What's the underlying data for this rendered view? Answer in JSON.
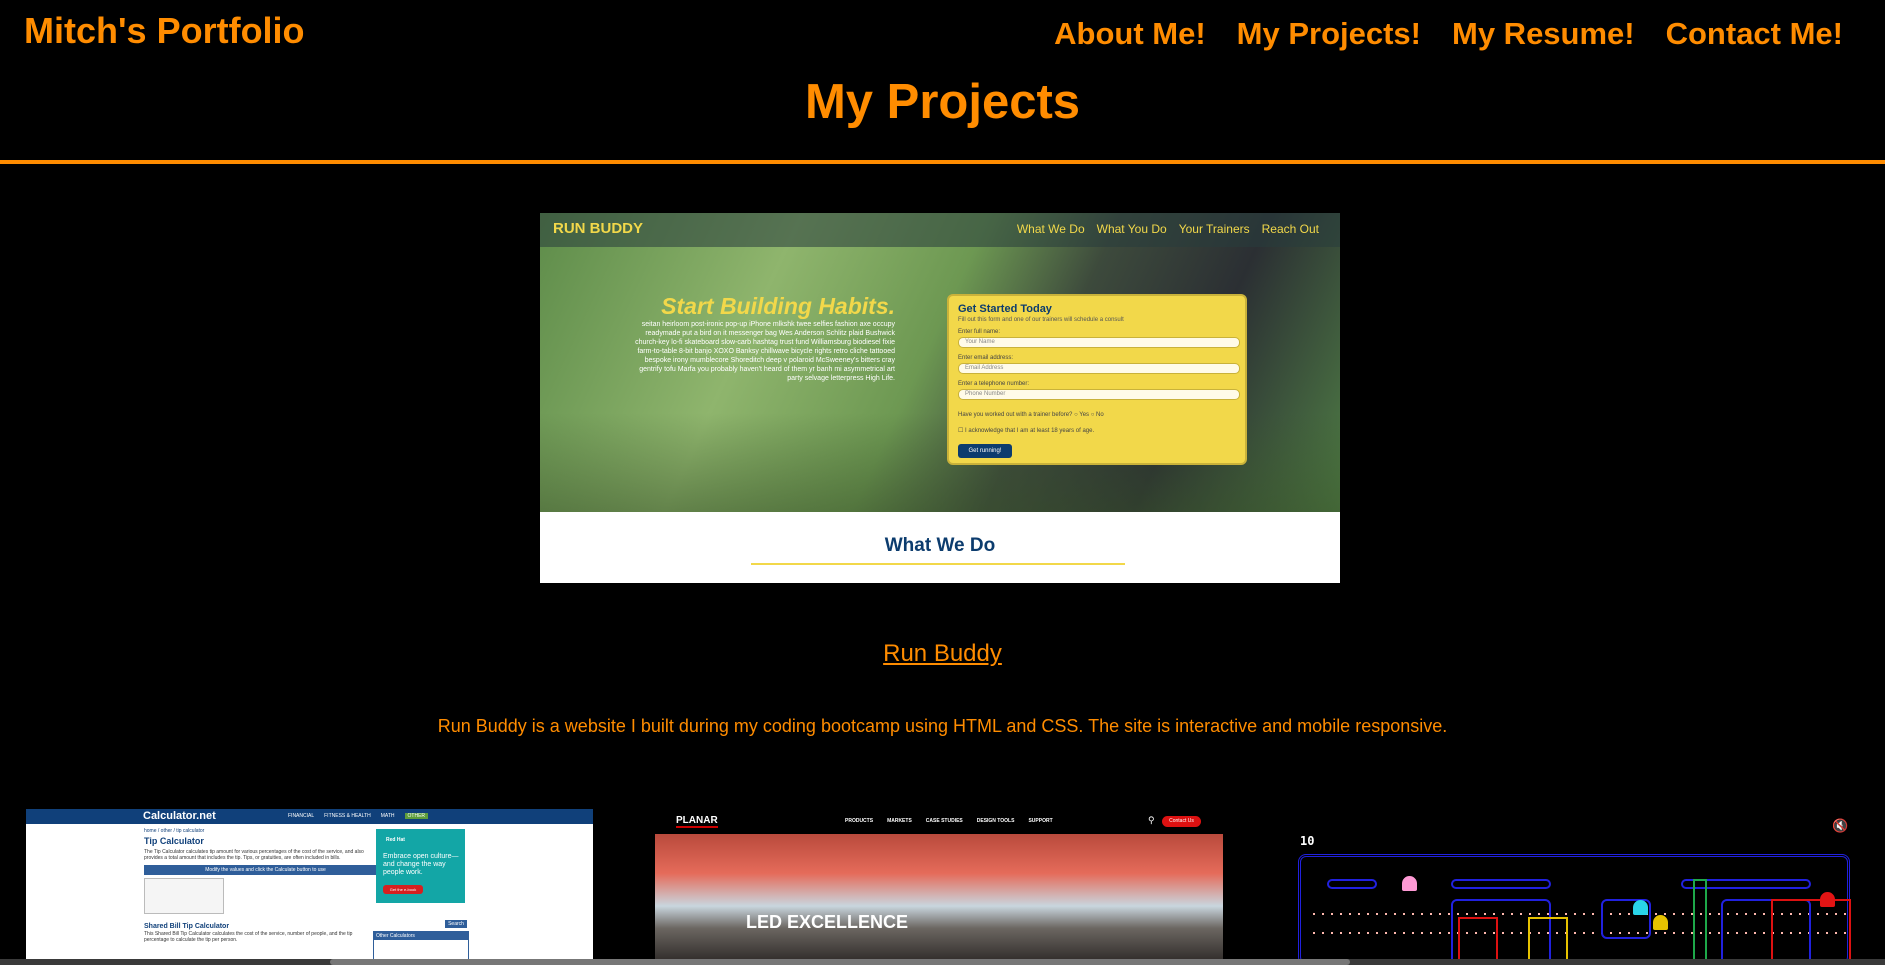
{
  "header": {
    "logo": "Mitch's Portfolio",
    "nav": [
      "About Me!",
      "My Projects!",
      "My Resume!",
      "Contact Me!"
    ],
    "page_heading": "My Projects"
  },
  "colors": {
    "accent": "#ff8c00",
    "background": "#000000",
    "run_buddy_yellow": "#f2d84a",
    "run_buddy_navy": "#0c3c6e"
  },
  "featured_project": {
    "screenshot": {
      "brand": "RUN BUDDY",
      "nav": [
        "What We Do",
        "What You Do",
        "Your Trainers",
        "Reach Out"
      ],
      "headline": "Start Building Habits.",
      "blurb": "seitan heirloom post-ironic pop-up iPhone mlkshk twee selfies fashion axe occupy readymade put a bird on it messenger bag Wes Anderson Schlitz plaid Bushwick church-key lo-fi skateboard slow-carb hashtag trust fund Williamsburg biodiesel fixie farm-to-table 8-bit banjo XOXO Banksy chillwave bicycle rights retro cliche tattooed bespoke irony mumblecore Shoreditch deep v polaroid McSweeney's bitters cray gentrify tofu Marfa you probably haven't heard of them yr banh mi asymmetrical art party selvage letterpress High Life.",
      "form": {
        "title": "Get Started Today",
        "subtitle": "Fill out this form and one of our trainers will schedule a consult",
        "name_label": "Enter full name:",
        "name_placeholder": "Your Name",
        "email_label": "Enter email address:",
        "email_placeholder": "Email Address",
        "phone_label": "Enter a telephone number:",
        "phone_placeholder": "Phone Number",
        "question": "Have you worked out with a trainer before?",
        "yes": "Yes",
        "no": "No",
        "acknowledge": "I acknowledge that I am at least 18 years of age.",
        "button": "Get running!"
      },
      "section_title": "What We Do"
    },
    "title": "Run Buddy",
    "description": "Run Buddy is a website I built during my coding bootcamp using HTML and CSS. The site is interactive and mobile responsive."
  },
  "thumbnails": {
    "calculator": {
      "brand": "Calculator.net",
      "menu": [
        "FINANCIAL",
        "FITNESS & HEALTH",
        "MATH",
        "OTHER"
      ],
      "breadcrumb": "home / other / tip calculator",
      "title": "Tip Calculator",
      "intro": "The Tip Calculator calculates tip amount for various percentages of the cost of the service, and also provides a total amount that includes the tip. Tips, or gratuities, are often included in bills.",
      "band": "Modify the values and click the Calculate button to use",
      "shared_title": "Shared Bill Tip Calculator",
      "shared_intro": "This Shared Bill Tip Calculator calculates the cost of the service, number of people, and the tip percentage to calculate the tip per person.",
      "ad_title": "Red Hat",
      "ad_copy": "Embrace open culture—and change the way people work.",
      "ad_button": "Get the e-book",
      "search_button": "Search",
      "sidebar_title": "Other Calculators"
    },
    "planar": {
      "brand": "PLANAR",
      "menu": [
        "PRODUCTS",
        "MARKETS",
        "CASE STUDIES",
        "DESIGN TOOLS",
        "SUPPORT"
      ],
      "contact": "Contact Us",
      "tagline": "LED EXCELLENCE"
    },
    "pacman": {
      "score": "10"
    }
  }
}
